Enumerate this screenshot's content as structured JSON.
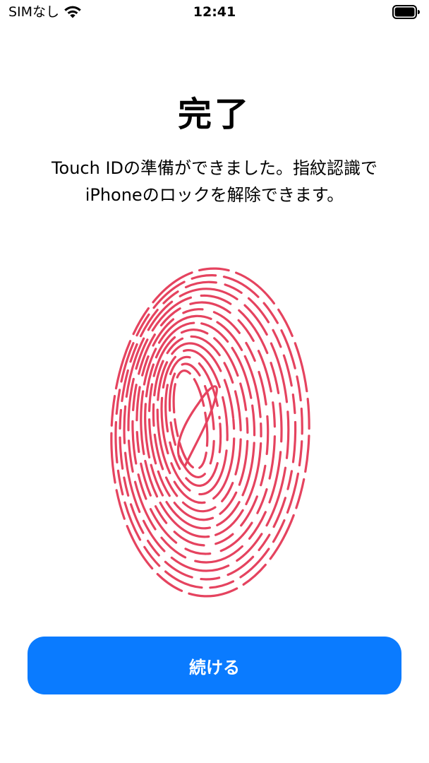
{
  "status_bar": {
    "carrier": "SIMなし",
    "time": "12:41",
    "wifi_icon": "wifi-icon",
    "battery_icon": "battery-full-icon"
  },
  "main": {
    "title": "完了",
    "description_line1": "Touch IDの準備ができました。指紋認識で",
    "description_line2": "iPhoneのロックを解除できます。",
    "illustration_icon": "fingerprint-icon"
  },
  "continue_button": {
    "label": "続ける"
  },
  "colors": {
    "accent": "#0a7bff",
    "fingerprint": "#e5435f",
    "background": "#ffffff",
    "text": "#000000"
  }
}
